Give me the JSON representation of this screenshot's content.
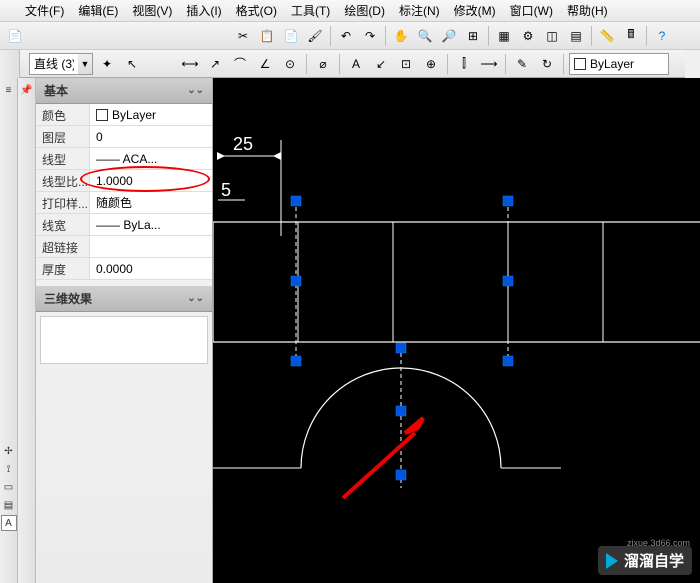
{
  "menubar": {
    "items": [
      "文件(F)",
      "编辑(E)",
      "视图(V)",
      "插入(I)",
      "格式(O)",
      "工具(T)",
      "绘图(D)",
      "标注(N)",
      "修改(M)",
      "窗口(W)",
      "帮助(H)"
    ]
  },
  "combo": {
    "value": "直线 (3)"
  },
  "bylayer_combo": "ByLayer",
  "panels": {
    "basic": {
      "title": "基本",
      "rows": [
        {
          "label": "颜色",
          "value": "ByLayer",
          "swatch": true
        },
        {
          "label": "图层",
          "value": "0"
        },
        {
          "label": "线型",
          "value": "—— ACA...",
          "line": true
        },
        {
          "label": "线型比...",
          "value": "1.0000",
          "highlight": true
        },
        {
          "label": "打印样...",
          "value": "随颜色"
        },
        {
          "label": "线宽",
          "value": "—— ByLa...",
          "line": true
        },
        {
          "label": "超链接",
          "value": ""
        },
        {
          "label": "厚度",
          "value": "0.0000"
        }
      ]
    },
    "threed": {
      "title": "三维效果"
    }
  },
  "dim_text": "25",
  "watermark": {
    "main": "溜溜自学",
    "sub": "zixue.3d66.com"
  }
}
